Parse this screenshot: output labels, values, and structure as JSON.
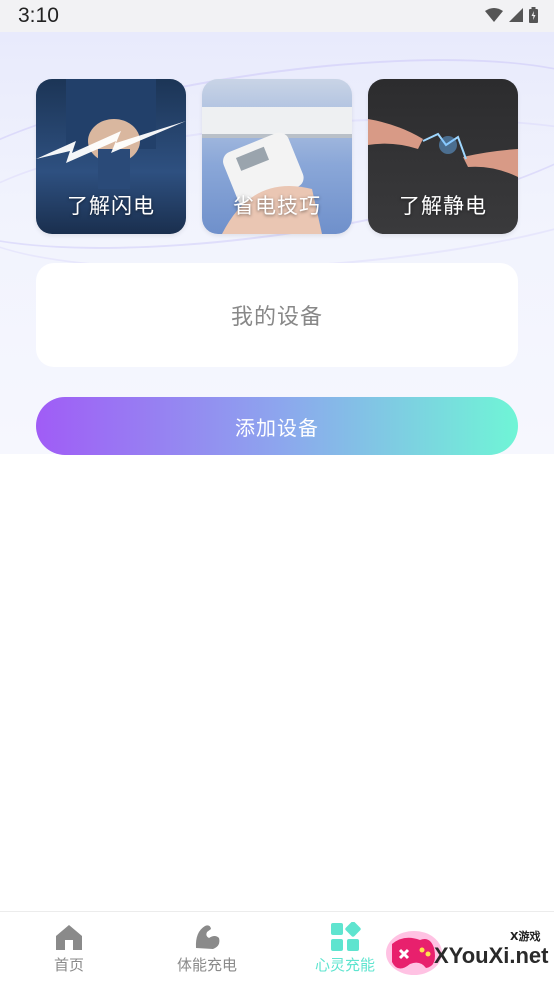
{
  "status_bar": {
    "time": "3:10"
  },
  "cards": [
    {
      "label": "了解闪电"
    },
    {
      "label": "省电技巧"
    },
    {
      "label": "了解静电"
    }
  ],
  "device_section": {
    "title": "我的设备"
  },
  "add_button": {
    "label": "添加设备"
  },
  "bottom_nav": {
    "items": [
      {
        "label": "首页"
      },
      {
        "label": "体能充电"
      },
      {
        "label": "心灵充能"
      }
    ],
    "active_color": "#5fe4cf",
    "inactive_color": "#8a8a8a"
  },
  "watermark": {
    "text": "XYouXi.net",
    "small_text": "X游戏"
  },
  "colors": {
    "button_gradient_start": "#a05cf6",
    "button_gradient_end": "#6ff5d6"
  }
}
